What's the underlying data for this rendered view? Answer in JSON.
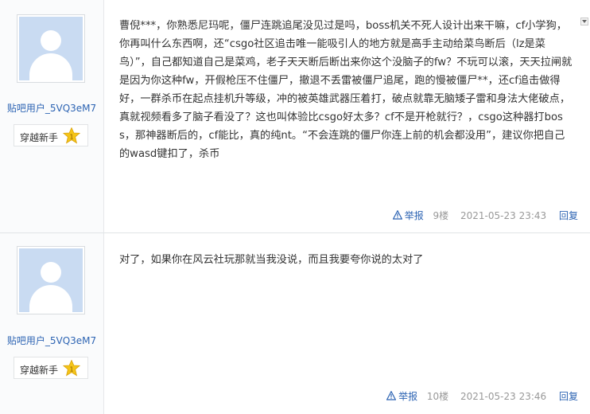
{
  "posts": [
    {
      "author": {
        "name": "贴吧用户_5VQ3eM7",
        "badge": "穿越新手",
        "level": "1"
      },
      "content": "曹倪***，你熟悉尼玛呢，僵尸连跳追尾没见过是吗，boss机关不死人设计出来干嘛，cf小学狗，你再叫什么东西啊，还“csgo社区追击唯一能吸引人的地方就是高手主动给菜鸟断后（lz是菜鸟）”，自己都知道自己是菜鸡，老子天天断后断出来你这个没脑子的fw？不玩可以滚，天天拉闸就是因为你这种fw，开假枪压不住僵尸，撤退不丢雷被僵尸追尾，跑的慢被僵尸**，还cf追击做得好，一群杀币在起点挂机升等级，冲的被英雄武器压着打，破点就靠无脑矮子雷和身法大佬破点，真就视频看多了脑子看没了？这也叫体验比csgo好太多？cf不是开枪就行？，csgo这种器打boss，那神器断后的，cf能比，真的纯nt。“不会连跳的僵尸你连上前的机会都没用”，建议你把自己的wasd键扣了，杀币",
      "tail": {
        "report": "举报",
        "floor": "9楼",
        "time": "2021-05-23 23:43",
        "reply": "回复"
      }
    },
    {
      "author": {
        "name": "贴吧用户_5VQ3eM7",
        "badge": "穿越新手",
        "level": "1"
      },
      "content": "对了，如果你在风云社玩那就当我没说，而且我要夸你说的太对了",
      "tail": {
        "report": "举报",
        "floor": "10楼",
        "time": "2021-05-23 23:46",
        "reply": "回复"
      }
    }
  ],
  "colors": {
    "link": "#2d64b3",
    "meta": "#999999",
    "avatar_bg": "#c9dbf2",
    "level_badge": "#f5c518"
  },
  "icons": [
    "default-avatar-icon",
    "level-star-icon",
    "report-warning-icon",
    "scroll-down-arrow-icon"
  ]
}
